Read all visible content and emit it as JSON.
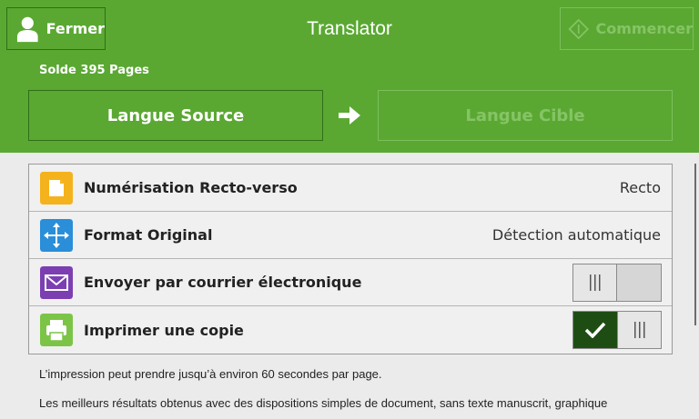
{
  "header": {
    "title": "Translator",
    "close_label": "Fermer",
    "start_label": "Commencer",
    "balance": "Solde 395 Pages",
    "source_label": "Langue Source",
    "target_label": "Langue Cible"
  },
  "settings": {
    "duplex": {
      "label": "Numérisation Recto-verso",
      "value": "Recto"
    },
    "format": {
      "label": "Format Original",
      "value": "Détection automatique"
    },
    "email": {
      "label": "Envoyer par courrier électronique",
      "enabled": false
    },
    "print": {
      "label": "Imprimer une copie",
      "enabled": true
    }
  },
  "notes": {
    "line1": "L’impression peut prendre jusqu’à environ 60 secondes par page.",
    "line2": "Les meilleurs résultats obtenus avec des dispositions simples de document, sans texte manuscrit, graphique"
  },
  "colors": {
    "header_bg": "#5aa832",
    "duplex_icon": "#f4b21c",
    "format_icon": "#2a8ed8",
    "email_icon": "#7b3fb2",
    "print_icon": "#7cc447",
    "toggle_on": "#1e4d14"
  }
}
